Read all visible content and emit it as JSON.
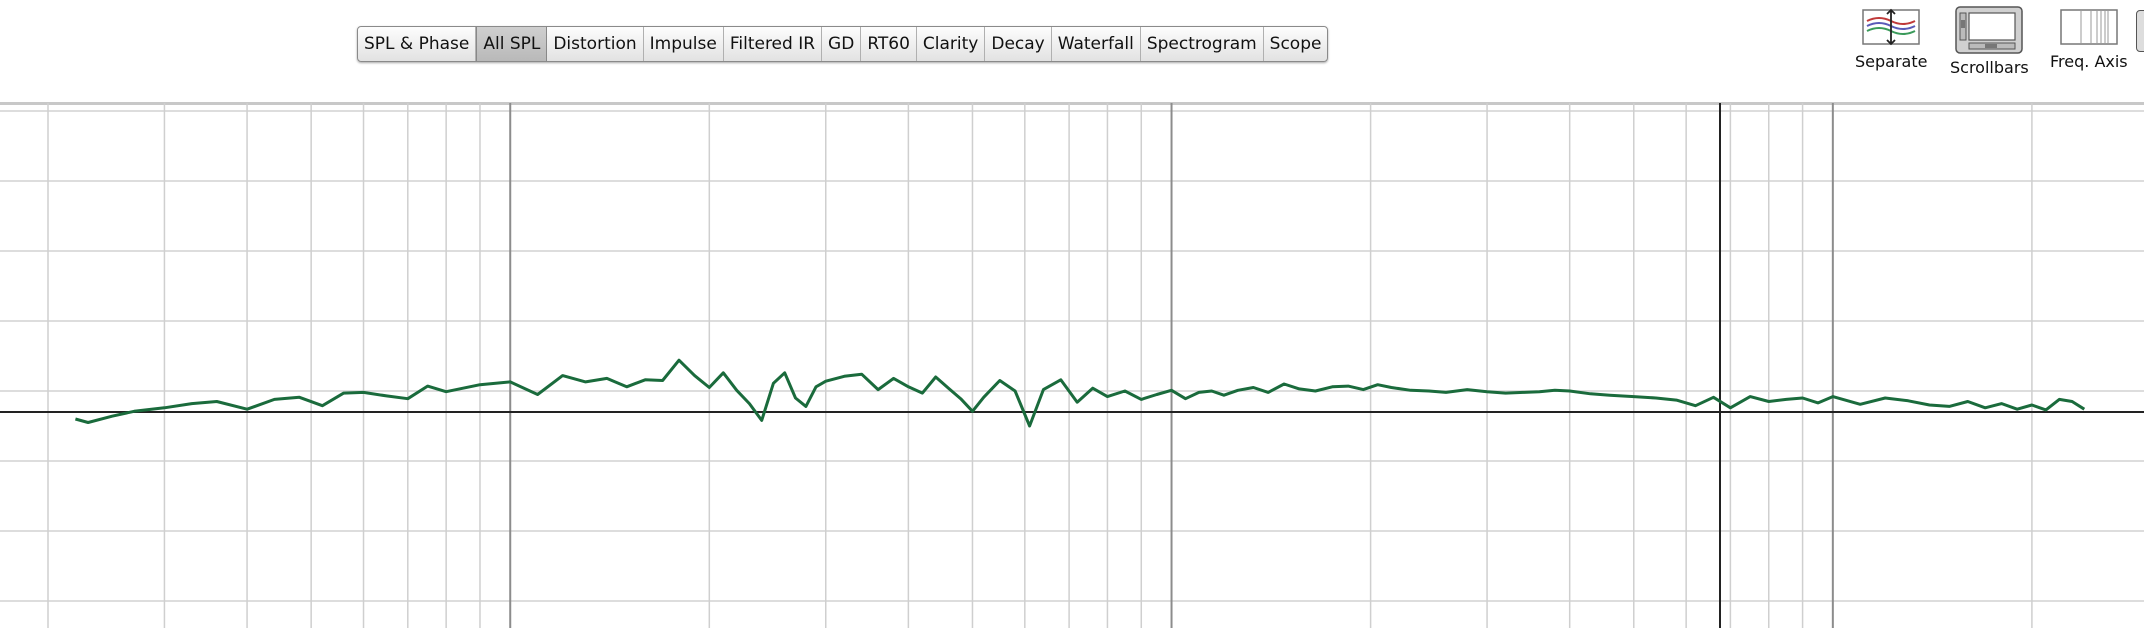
{
  "tabs": [
    {
      "label": "SPL & Phase",
      "active": false
    },
    {
      "label": "All SPL",
      "active": true
    },
    {
      "label": "Distortion",
      "active": false
    },
    {
      "label": "Impulse",
      "active": false
    },
    {
      "label": "Filtered IR",
      "active": false
    },
    {
      "label": "GD",
      "active": false
    },
    {
      "label": "RT60",
      "active": false
    },
    {
      "label": "Clarity",
      "active": false
    },
    {
      "label": "Decay",
      "active": false
    },
    {
      "label": "Waterfall",
      "active": false
    },
    {
      "label": "Spectrogram",
      "active": false
    },
    {
      "label": "Scope",
      "active": false
    }
  ],
  "toolbar": {
    "separate": {
      "label": "Separate",
      "icon": "separate-traces-icon"
    },
    "scrollbars": {
      "label": "Scrollbars",
      "icon": "scrollbars-icon",
      "active": true
    },
    "freq_axis": {
      "label": "Freq. Axis",
      "icon": "freq-axis-icon"
    }
  },
  "chart_data": {
    "type": "line",
    "x_scale": "log",
    "grid": true,
    "trace_color": "#1a6b3c",
    "reference_level": 0,
    "series": [
      {
        "x": [
          22,
          23,
          25,
          27,
          30,
          33,
          36,
          40,
          44,
          48,
          52,
          56,
          60,
          65,
          70,
          75,
          80,
          90,
          100,
          110,
          120,
          130,
          140,
          150,
          160,
          170,
          180,
          190,
          200,
          210,
          220,
          230,
          240,
          250,
          260,
          270,
          280,
          290,
          300,
          320,
          340,
          360,
          380,
          400,
          420,
          440,
          460,
          480,
          500,
          520,
          550,
          580,
          610,
          640,
          680,
          720,
          760,
          800,
          850,
          900,
          950,
          1000,
          1050,
          1100,
          1150,
          1200,
          1260,
          1330,
          1400,
          1480,
          1560,
          1650,
          1750,
          1850,
          1950,
          2050,
          2150,
          2300,
          2450,
          2600,
          2800,
          3000,
          3200,
          3400,
          3600,
          3800,
          4000,
          4300,
          4600,
          5000,
          5400,
          5800,
          6200,
          6600,
          7000,
          7500,
          8000,
          8500,
          9000,
          9500,
          10000,
          11000,
          12000,
          13000,
          14000,
          15000,
          16000,
          17000,
          18000,
          19000,
          20000,
          21000,
          22000,
          23000,
          24000
        ],
        "y": [
          -1.0,
          -1.5,
          -0.6,
          0.1,
          0.6,
          1.2,
          1.5,
          0.4,
          1.8,
          2.1,
          0.9,
          2.7,
          2.8,
          2.3,
          1.9,
          3.7,
          2.9,
          3.9,
          4.3,
          2.5,
          5.2,
          4.3,
          4.8,
          3.6,
          4.6,
          4.5,
          7.4,
          5.2,
          3.5,
          5.6,
          3.1,
          1.2,
          -1.2,
          4.1,
          5.6,
          2.0,
          0.8,
          3.6,
          4.4,
          5.1,
          5.4,
          3.2,
          4.8,
          3.6,
          2.7,
          5.0,
          3.4,
          1.9,
          0.1,
          2.1,
          4.5,
          3.0,
          -2.0,
          3.2,
          4.6,
          1.4,
          3.4,
          2.2,
          3.0,
          1.8,
          2.5,
          3.1,
          1.9,
          2.8,
          3.0,
          2.4,
          3.1,
          3.5,
          2.8,
          4.0,
          3.3,
          3.0,
          3.6,
          3.7,
          3.2,
          3.9,
          3.5,
          3.1,
          3.0,
          2.8,
          3.2,
          2.9,
          2.7,
          2.8,
          2.9,
          3.1,
          3.0,
          2.6,
          2.4,
          2.2,
          2.0,
          1.7,
          0.9,
          2.1,
          0.6,
          2.2,
          1.5,
          1.8,
          2.0,
          1.3,
          2.2,
          1.1,
          2.0,
          1.6,
          1.0,
          0.8,
          1.5,
          0.6,
          1.2,
          0.4,
          1.0,
          0.3,
          1.8,
          1.5,
          0.4
        ]
      }
    ]
  }
}
